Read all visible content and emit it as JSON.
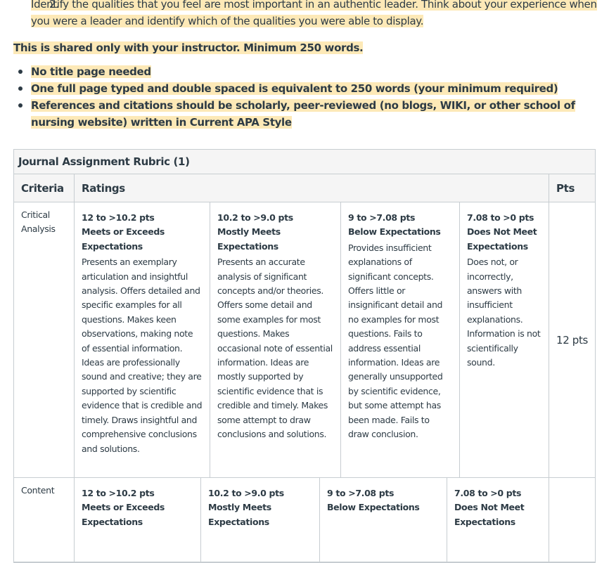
{
  "instructions": {
    "item_number": "2.",
    "item_text": "Identify the qualities that you feel are most important in an authentic leader. Think about your experience when you were a leader and identify which of the qualities you were able to display.",
    "shared_note": "This is shared only with your instructor.  Minimum 250  words.",
    "bullets": [
      "No title page needed",
      "One full page typed and double spaced is equivalent to 250 words (your minimum required)",
      "References and citations should be scholarly, peer-reviewed (no blogs, WIKI, or other school of nursing website) written in Current APA Style"
    ]
  },
  "rubric": {
    "title": "Journal Assignment Rubric (1)",
    "headers": {
      "criteria": "Criteria",
      "ratings": "Ratings",
      "pts": "Pts"
    },
    "rows": [
      {
        "criterion": "Critical Analysis",
        "points": "12 pts",
        "ratings": [
          {
            "pts": "12 to >10.2 pts",
            "label": "Meets or Exceeds Expectations",
            "description": "Presents an exemplary articulation and insightful analysis. Offers detailed and specific examples for all questions. Makes keen observations, making note of essential information. Ideas are professionally sound and creative; they are supported by scientific evidence that is credible and timely. Draws insightful and comprehensive conclusions and solutions."
          },
          {
            "pts": "10.2 to >9.0 pts",
            "label": "Mostly Meets Expectations",
            "description": "Presents an accurate analysis of significant concepts and/or theories. Offers some detail and some examples for most questions. Makes occasional note of essential information. Ideas are mostly supported by scientific evidence that is credible and timely. Makes some attempt to draw conclusions and solutions."
          },
          {
            "pts": "9 to >7.08 pts",
            "label": "Below Expectations",
            "description": "Provides insufficient explanations of significant concepts. Offers little or insignificant detail and no examples for most questions. Fails to address essential information. Ideas are generally unsupported by scientific evidence, but some attempt has been made. Fails to draw conclusion."
          },
          {
            "pts": "7.08 to >0 pts",
            "label": "Does Not Meet Expectations",
            "description": "Does not, or incorrectly, answers with insufficient explanations. Information is not scientifically sound."
          }
        ]
      },
      {
        "criterion": "Content",
        "points": "",
        "ratings": [
          {
            "pts": "12 to >10.2 pts",
            "label": "Meets or Exceeds Expectations",
            "description": ""
          },
          {
            "pts": "10.2 to >9.0 pts",
            "label": "Mostly Meets Expectations",
            "description": ""
          },
          {
            "pts": "9 to >7.08 pts",
            "label": "Below Expectations",
            "description": ""
          },
          {
            "pts": "7.08 to >0 pts",
            "label": "Does Not Meet Expectations",
            "description": ""
          }
        ]
      }
    ]
  }
}
